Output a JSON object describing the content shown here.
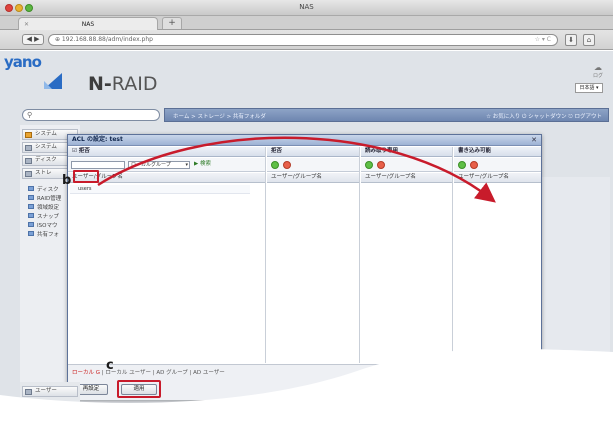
{
  "window": {
    "title": "NAS"
  },
  "tabs": [
    {
      "label": "NAS"
    }
  ],
  "browser": {
    "url": "http://192.168.xx.xx/adm/index.php",
    "url_display": "⊕ 192.168.88.88/adm/index.php"
  },
  "header": {
    "brand": "yano",
    "product_prefix": "N-",
    "product_name": "RAID",
    "lang": "日本語",
    "right_label": "ログ"
  },
  "search": {
    "placeholder": ""
  },
  "breadcrumb": "ホーム > ストレージ > 共有フォルダ",
  "topnav": "☆ お気に入り  ⏻ シャットダウン  ⎋ ログアウト",
  "sidebar": {
    "sections": [
      "システム",
      "システム",
      "ディスク",
      "ストレ"
    ],
    "items": [
      "ディスク",
      "RAID管理",
      "領域設定",
      "スナップ",
      "ISOマウ",
      "共有フォ"
    ],
    "bottom": "ユーザー"
  },
  "dialog": {
    "title": "ACL の設定: test",
    "columns": [
      {
        "header": "☑ 拒否",
        "sub": "ユーザー/グループ名"
      },
      {
        "header": "拒否",
        "sub": "ユーザー/グループ名"
      },
      {
        "header": "読み取り専用",
        "sub": "ユーザー/グループ名"
      },
      {
        "header": "書き込み可能",
        "sub": "ユーザー/グループ名"
      }
    ],
    "select_value": "ローカルグループ",
    "search_label": "検索",
    "row_value": "users",
    "footer_legend_red": "ローカル G",
    "footer_legend_rest": " | ローカル ユーザー | AD グループ | AD ユーザー",
    "reset_label": "再設定",
    "apply_label": "適用"
  },
  "annotations": {
    "b": "b",
    "c": "c"
  }
}
